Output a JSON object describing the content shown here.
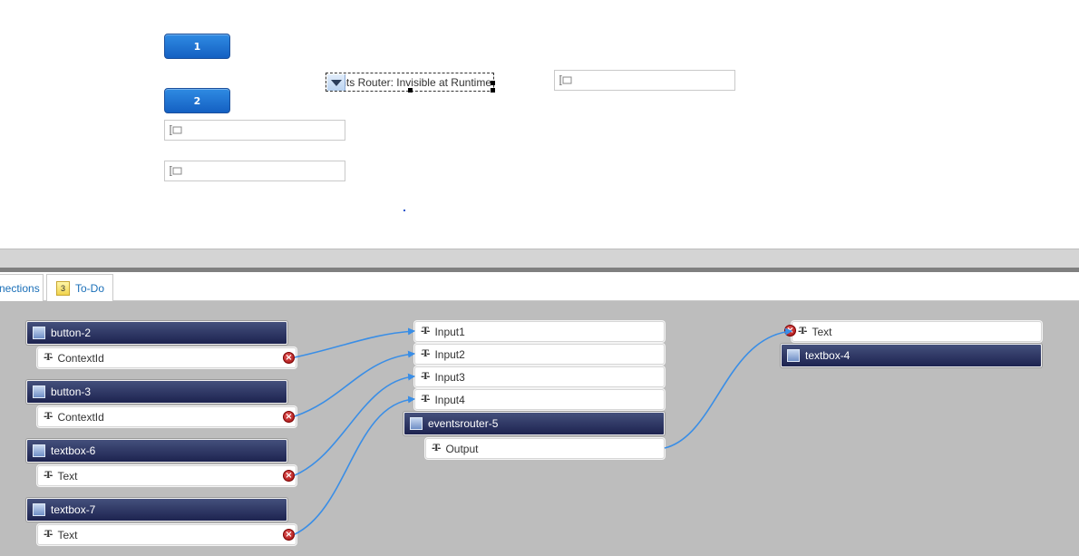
{
  "canvas": {
    "buttons": [
      {
        "label": "1"
      },
      {
        "label": "2"
      }
    ],
    "events_router_label": "nts Router: Invisible at Runtime"
  },
  "tabs": [
    {
      "label": "nections"
    },
    {
      "label": "To-Do",
      "badge": "3"
    }
  ],
  "connections": {
    "left_components": [
      {
        "name": "button-2",
        "property": "ContextId"
      },
      {
        "name": "button-3",
        "property": "ContextId"
      },
      {
        "name": "textbox-6",
        "property": "Text"
      },
      {
        "name": "textbox-7",
        "property": "Text"
      }
    ],
    "middle_component": {
      "inputs": [
        "Input1",
        "Input2",
        "Input3",
        "Input4"
      ],
      "name": "eventsrouter-5",
      "output": "Output"
    },
    "right_component": {
      "property": "Text",
      "name": "textbox-4"
    },
    "property_type_icon": "-T-",
    "wire_color": "#3a8ee6"
  }
}
